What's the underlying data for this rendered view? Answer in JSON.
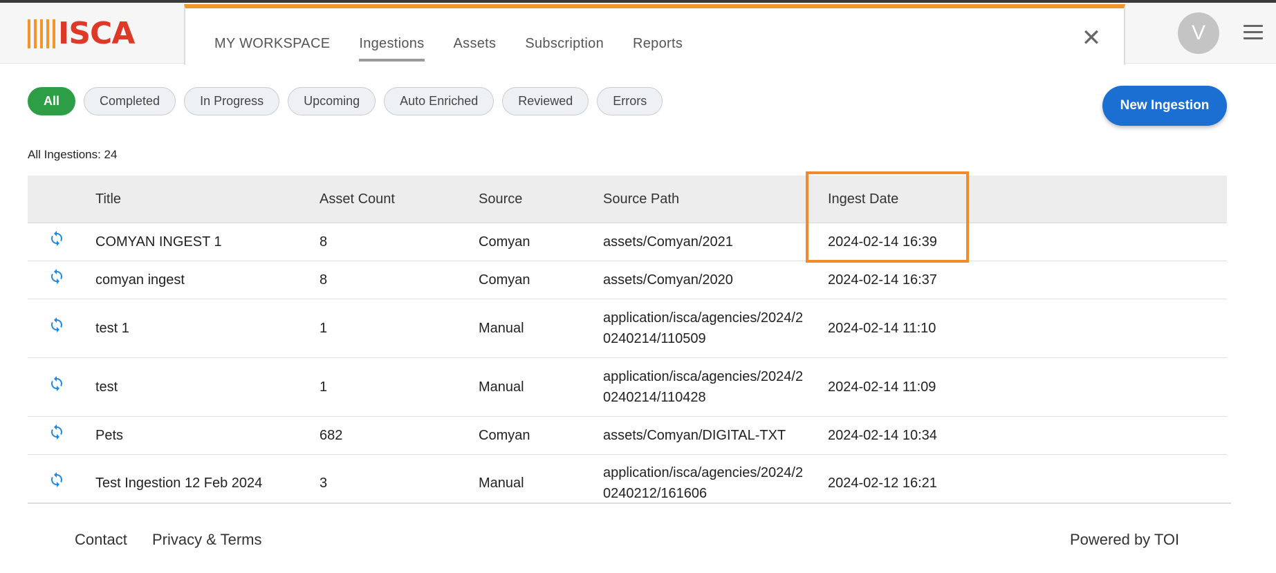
{
  "app": {
    "logo_text": "ISCA"
  },
  "nav": {
    "tabs": [
      {
        "label": "MY WORKSPACE"
      },
      {
        "label": "Ingestions"
      },
      {
        "label": "Assets"
      },
      {
        "label": "Subscription"
      },
      {
        "label": "Reports"
      }
    ],
    "active_tab": "Ingestions",
    "close_symbol": "✕"
  },
  "user": {
    "avatar_initial": "V"
  },
  "filters": [
    {
      "label": "All",
      "active": true
    },
    {
      "label": "Completed"
    },
    {
      "label": "In Progress"
    },
    {
      "label": "Upcoming"
    },
    {
      "label": "Auto Enriched"
    },
    {
      "label": "Reviewed"
    },
    {
      "label": "Errors"
    }
  ],
  "new_ingestion_label": "New Ingestion",
  "count_label": "All Ingestions: 24",
  "table": {
    "headers": {
      "title": "Title",
      "asset_count": "Asset Count",
      "source": "Source",
      "source_path": "Source Path",
      "ingest_date": "Ingest Date"
    },
    "rows": [
      {
        "title": "COMYAN INGEST 1",
        "asset_count": "8",
        "source": "Comyan",
        "source_path": "assets/Comyan/2021",
        "ingest_date": "2024-02-14 16:39"
      },
      {
        "title": "comyan ingest",
        "asset_count": "8",
        "source": "Comyan",
        "source_path": "assets/Comyan/2020",
        "ingest_date": "2024-02-14 16:37"
      },
      {
        "title": "test 1",
        "asset_count": "1",
        "source": "Manual",
        "source_path": "application/isca/agencies/2024/20240214/110509",
        "ingest_date": "2024-02-14 11:10"
      },
      {
        "title": "test",
        "asset_count": "1",
        "source": "Manual",
        "source_path": "application/isca/agencies/2024/20240214/110428",
        "ingest_date": "2024-02-14 11:09"
      },
      {
        "title": "Pets",
        "asset_count": "682",
        "source": "Comyan",
        "source_path": "assets/Comyan/DIGITAL-TXT",
        "ingest_date": "2024-02-14 10:34"
      },
      {
        "title": "Test Ingestion 12 Feb 2024",
        "asset_count": "3",
        "source": "Manual",
        "source_path": "application/isca/agencies/2024/20240212/161606",
        "ingest_date": "2024-02-12 16:21"
      }
    ],
    "row_icon": "sync-icon"
  },
  "highlight_color": "#f08a2c",
  "footer": {
    "contact": "Contact",
    "privacy": "Privacy & Terms",
    "powered": "Powered by TOI"
  }
}
